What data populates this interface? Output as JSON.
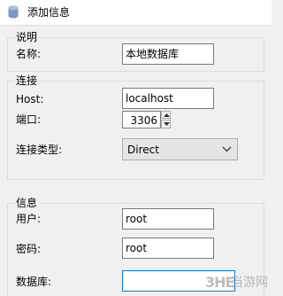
{
  "window": {
    "title": "添加信息"
  },
  "groups": {
    "description": {
      "title": "说明",
      "name_label": "名称:",
      "name_value": "本地数据库"
    },
    "connection": {
      "title": "连接",
      "host_label": "Host:",
      "host_value": "localhost",
      "port_label": "端口:",
      "port_value": "3306",
      "type_label": "连接类型:",
      "type_value": "Direct"
    },
    "info": {
      "title": "信息",
      "user_label": "用户:",
      "user_value": "root",
      "password_label": "密码:",
      "password_value": "root",
      "database_label": "数据库:",
      "database_value": ""
    }
  },
  "watermark": {
    "logo": "3HE",
    "text": "当游网"
  },
  "icons": {
    "app": "database-icon",
    "spin_up": "spin-up-icon",
    "spin_down": "spin-down-icon",
    "combo": "chevron-down-icon"
  },
  "colors": {
    "focus_border": "#0078d7",
    "group_border": "#d5dfe5",
    "dialog_bg": "#f0f0f0"
  }
}
